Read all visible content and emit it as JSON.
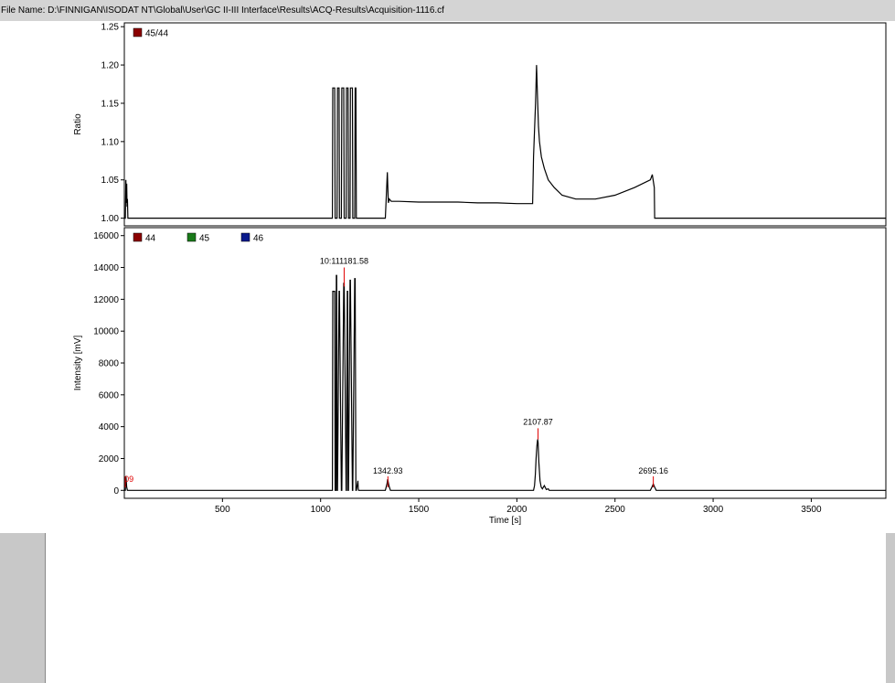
{
  "window": {
    "file_label": "File Name: D:\\FINNIGAN\\ISODAT NT\\Global\\User\\GC II-III Interface\\Results\\ACQ-Results\\Acquisition-1116.cf"
  },
  "colors": {
    "ratio_45_44": "#8b0000",
    "mass_44": "#8b0000",
    "mass_45": "#1a7a1a",
    "mass_46": "#0a1a8c",
    "trace": "#000000",
    "peak_label": "#e00000"
  },
  "chart_data": [
    {
      "type": "line",
      "ylabel": "Ratio",
      "xlim": [
        0,
        3880
      ],
      "ylim": [
        0.99,
        1.255
      ],
      "yticks": [
        1.0,
        1.05,
        1.1,
        1.15,
        1.2,
        1.25
      ],
      "ytick_labels": [
        "1.00",
        "1.05",
        "1.10",
        "1.15",
        "1.20",
        "1.25"
      ],
      "legend": [
        {
          "name": "45/44",
          "color": "#8b0000"
        }
      ],
      "legend_position": "top-left",
      "series": [
        {
          "name": "45/44",
          "x": [
            0,
            5,
            8,
            10,
            12,
            14,
            16,
            18,
            20,
            200,
            400,
            600,
            800,
            1000,
            1060,
            1062,
            1072,
            1074,
            1084,
            1086,
            1094,
            1096,
            1106,
            1108,
            1118,
            1120,
            1130,
            1132,
            1140,
            1142,
            1150,
            1152,
            1162,
            1164,
            1174,
            1176,
            1180,
            1182,
            1192,
            1194,
            1250,
            1330,
            1340,
            1345,
            1350,
            1360,
            1400,
            1500,
            1600,
            1700,
            1800,
            1900,
            2000,
            2080,
            2085,
            2095,
            2100,
            2105,
            2110,
            2115,
            2125,
            2140,
            2160,
            2190,
            2230,
            2300,
            2400,
            2500,
            2600,
            2680,
            2690,
            2700,
            2702,
            2720,
            3000,
            3500,
            3880
          ],
          "y": [
            1.0,
            1.0,
            1.05,
            1.02,
            1.045,
            1.015,
            1.025,
            1.0,
            1.0,
            1.0,
            1.0,
            1.0,
            1.0,
            1.0,
            1.0,
            1.17,
            1.17,
            1.0,
            1.0,
            1.17,
            1.17,
            1.0,
            1.0,
            1.17,
            1.17,
            1.0,
            1.0,
            1.17,
            1.17,
            1.0,
            1.0,
            1.17,
            1.17,
            1.0,
            1.0,
            1.17,
            1.17,
            1.0,
            1.0,
            1.0,
            1.0,
            1.0,
            1.06,
            1.02,
            1.025,
            1.022,
            1.022,
            1.021,
            1.021,
            1.021,
            1.02,
            1.02,
            1.019,
            1.019,
            1.08,
            1.15,
            1.2,
            1.16,
            1.12,
            1.1,
            1.08,
            1.065,
            1.05,
            1.04,
            1.03,
            1.025,
            1.025,
            1.03,
            1.04,
            1.05,
            1.057,
            1.04,
            1.0,
            1.0,
            1.0,
            1.0,
            1.0
          ]
        }
      ]
    },
    {
      "type": "line",
      "ylabel": "Intensity [mV]",
      "xlabel": "Time [s]",
      "xlim": [
        0,
        3880
      ],
      "ylim": [
        -500,
        16500
      ],
      "xticks": [
        500,
        1000,
        1500,
        2000,
        2500,
        3000,
        3500
      ],
      "xtick_labels": [
        "500",
        "1000",
        "1500",
        "2000",
        "2500",
        "3000",
        "3500"
      ],
      "yticks": [
        0,
        2000,
        4000,
        6000,
        8000,
        10000,
        12000,
        14000,
        16000
      ],
      "ytick_labels": [
        "0",
        "2000",
        "4000",
        "6000",
        "8000",
        "10000",
        "12000",
        "14000",
        "16000"
      ],
      "legend": [
        {
          "name": "44",
          "color": "#8b0000"
        },
        {
          "name": "45",
          "color": "#1a7a1a"
        },
        {
          "name": "46",
          "color": "#0a1a8c"
        }
      ],
      "legend_position": "top-left",
      "series": [
        {
          "name": "44",
          "x": [
            0,
            5,
            8,
            12,
            16,
            20,
            1000,
            1060,
            1062,
            1072,
            1074,
            1078,
            1080,
            1082,
            1084,
            1086,
            1094,
            1096,
            1106,
            1108,
            1118,
            1120,
            1130,
            1132,
            1136,
            1138,
            1140,
            1142,
            1150,
            1152,
            1162,
            1164,
            1174,
            1176,
            1180,
            1182,
            1190,
            1192,
            1194,
            1330,
            1338,
            1342,
            1348,
            1356,
            2085,
            2090,
            2094,
            2098,
            2102,
            2106,
            2108,
            2112,
            2118,
            2124,
            2130,
            2140,
            2150,
            2160,
            2165,
            2170,
            2680,
            2688,
            2695,
            2702,
            2710,
            3880
          ],
          "y": [
            0,
            0,
            900,
            200,
            0,
            0,
            0,
            0,
            12500,
            12500,
            0,
            0,
            13500,
            13500,
            0,
            0,
            12500,
            12500,
            0,
            0,
            13000,
            13000,
            0,
            0,
            12500,
            12500,
            0,
            0,
            13200,
            13200,
            0,
            0,
            13300,
            13300,
            0,
            0,
            600,
            100,
            0,
            0,
            400,
            700,
            300,
            0,
            0,
            300,
            1000,
            2000,
            2800,
            3200,
            3000,
            1800,
            600,
            200,
            100,
            300,
            50,
            100,
            0,
            0,
            0,
            200,
            400,
            200,
            0,
            0
          ]
        }
      ],
      "peak_labels": [
        {
          "text": "09",
          "x": 5,
          "color": "red"
        },
        {
          "text": "10:111181.58",
          "x": 1120,
          "color": "black"
        },
        {
          "text": "1342.93",
          "x": 1342.93,
          "color": "black"
        },
        {
          "text": "2107.87",
          "x": 2107.87,
          "color": "black"
        },
        {
          "text": "2695.16",
          "x": 2695.16,
          "color": "black"
        }
      ]
    }
  ]
}
